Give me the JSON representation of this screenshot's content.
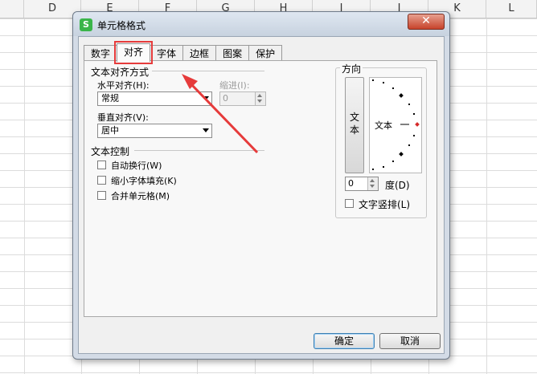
{
  "sheet": {
    "columns": [
      "D",
      "E",
      "F",
      "G",
      "H",
      "I",
      "J",
      "K",
      "L"
    ]
  },
  "dialog": {
    "app_icon_letter": "S",
    "title": "单元格格式",
    "close_symbol": "✕",
    "tabs": [
      {
        "label": "数字"
      },
      {
        "label": "对齐"
      },
      {
        "label": "字体"
      },
      {
        "label": "边框"
      },
      {
        "label": "图案"
      },
      {
        "label": "保护"
      }
    ],
    "active_tab": "对齐",
    "text_alignment": {
      "group_label": "文本对齐方式",
      "horizontal_label": "水平对齐(H):",
      "horizontal_value": "常规",
      "indent_label": "缩进(I):",
      "indent_value": "0",
      "vertical_label": "垂直对齐(V):",
      "vertical_value": "居中"
    },
    "text_control": {
      "group_label": "文本控制",
      "wrap_text": {
        "label": "自动换行(W)",
        "checked": false
      },
      "shrink_to_fit": {
        "label": "缩小字体填充(K)",
        "checked": false
      },
      "merge_cells": {
        "label": "合并单元格(M)",
        "checked": false
      }
    },
    "orientation": {
      "group_label": "方向",
      "vertical_text_chars": [
        "文",
        "本"
      ],
      "dial_text": "文本",
      "degree_value": "0",
      "degree_label": "度(D)",
      "vertical_layout_label": "文字竖排(L)",
      "vertical_layout_checked": false
    },
    "buttons": {
      "ok": "确定",
      "cancel": "取消"
    },
    "colors": {
      "annotation_red": "#e63b3b",
      "dial_marker": "#d62b2b"
    }
  }
}
